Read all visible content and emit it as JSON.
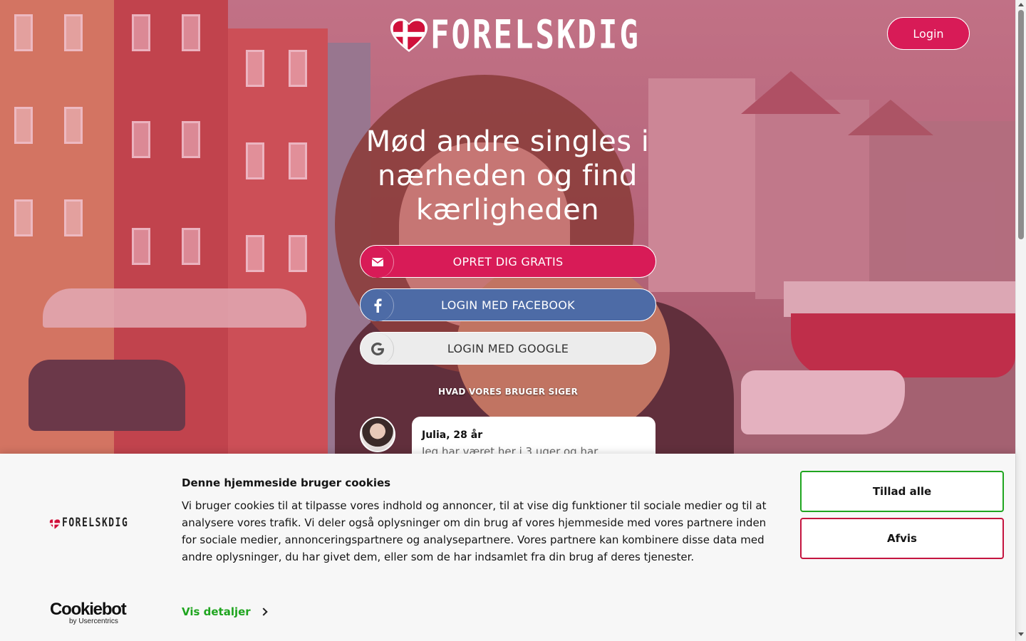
{
  "brand": {
    "name": "FORELSKDIG",
    "colors": {
      "primary": "#d81b57",
      "facebook": "#4d6ba6",
      "google_bg": "#ececec",
      "cookie_allow": "#1fa51f",
      "cookie_deny": "#c4143f"
    }
  },
  "header": {
    "login_label": "Login"
  },
  "hero": {
    "headline": "Mød andre singles i nærheden og find kærligheden",
    "buttons": [
      {
        "label": "OPRET DIG GRATIS",
        "icon": "envelope-icon"
      },
      {
        "label": "LOGIN MED FACEBOOK",
        "icon": "facebook-icon"
      },
      {
        "label": "LOGIN MED GOOGLE",
        "icon": "google-icon"
      }
    ]
  },
  "testimonials": {
    "title": "HVAD VORES BRUGER SIGER",
    "items": [
      {
        "name": "Julia, 28 år",
        "text": "Jeg har været her i 3 uger og har"
      }
    ]
  },
  "cookie_banner": {
    "brand_logo_text": "FORELSKDIG",
    "title": "Denne hjemmeside bruger cookies",
    "body": "Vi bruger cookies til at tilpasse vores indhold og annoncer, til at vise dig funktioner til sociale medier og til at analysere vores trafik. Vi deler også oplysninger om din brug af vores hjemmeside med vores partnere inden for sociale medier, annonceringspartnere og analysepartnere. Vores partnere kan kombinere disse data med andre oplysninger, du har givet dem, eller som de har indsamlet fra din brug af deres tjenester.",
    "details_label": "Vis detaljer",
    "allow_label": "Tillad alle",
    "deny_label": "Afvis",
    "provider": {
      "name": "Cookiebot",
      "sub": "by Usercentrics"
    }
  }
}
